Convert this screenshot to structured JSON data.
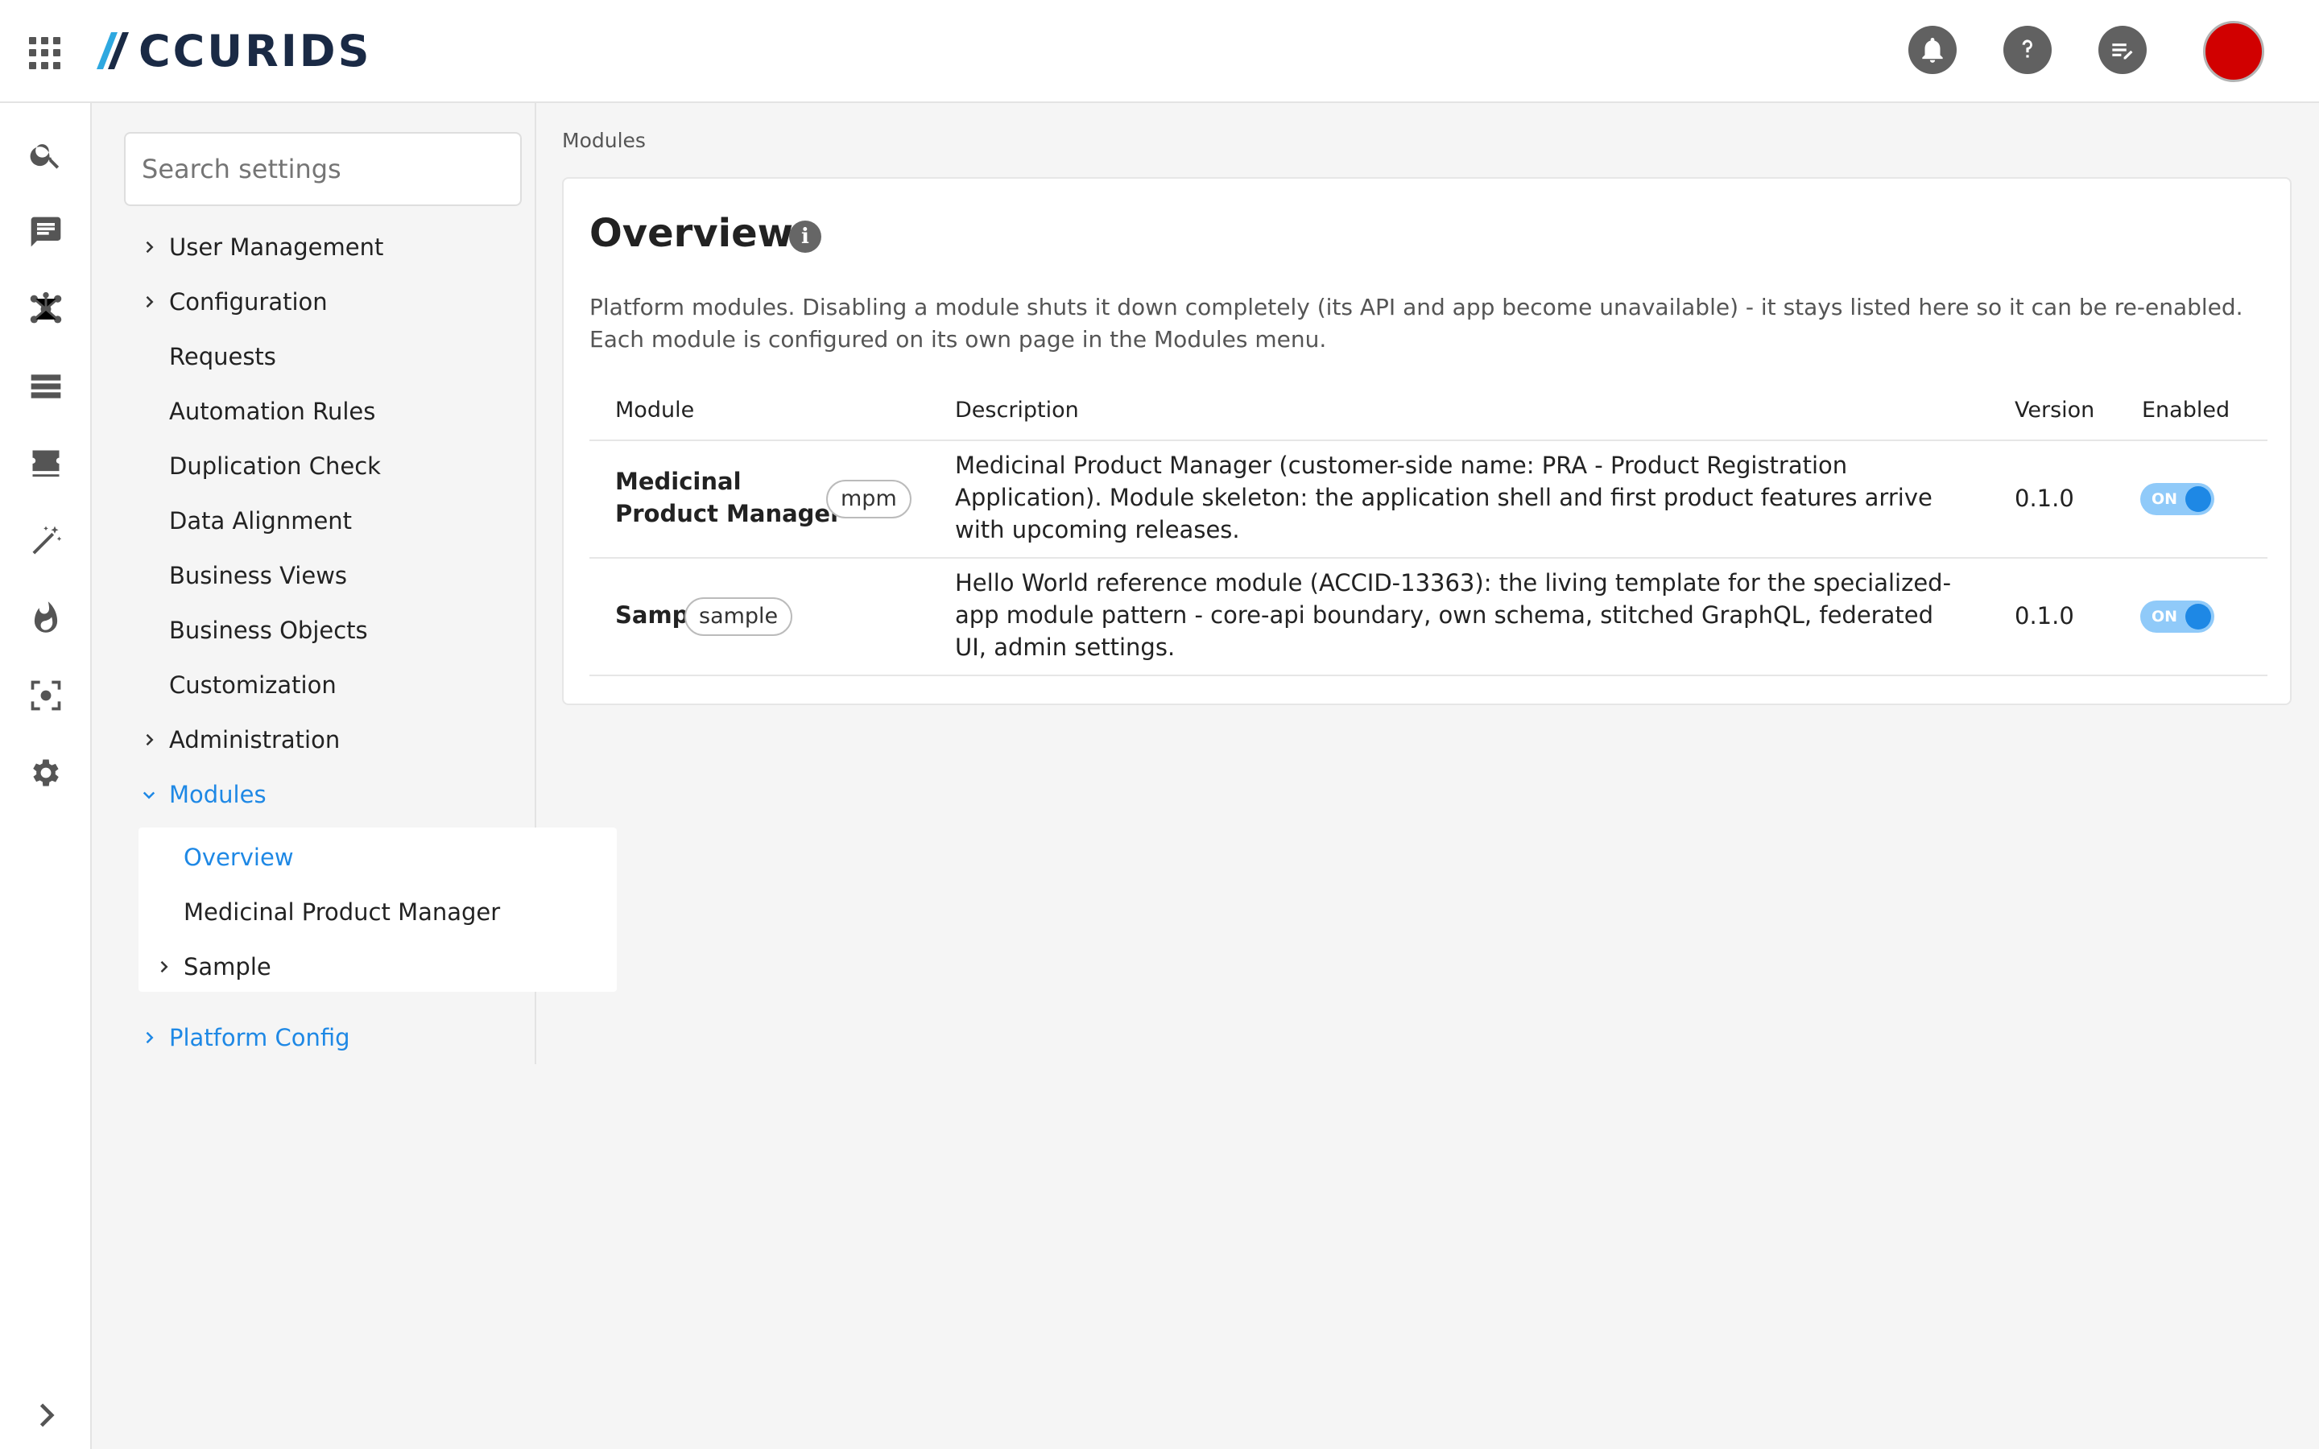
{
  "app": {
    "brand": "ACCURIDS",
    "brand_rest": "CCURIDS",
    "colors": {
      "accent": "#1e88e5",
      "avatar": "#d10000",
      "toggle_track": "#90caf9"
    }
  },
  "topbar": {
    "icons": [
      "apps-grid-icon",
      "bell-icon",
      "help-icon",
      "notes-icon"
    ]
  },
  "rail": {
    "icons": [
      "search-icon",
      "chat-icon",
      "network-icon",
      "list-icon",
      "ticket-icon",
      "magic-wand-icon",
      "flame-icon",
      "scan-icon",
      "gear-icon",
      "chevron-right-icon"
    ]
  },
  "settings_nav": {
    "search_placeholder": "Search settings",
    "items": [
      {
        "label": "User Management",
        "chevron": "right"
      },
      {
        "label": "Configuration",
        "chevron": "right"
      },
      {
        "label": "Requests"
      },
      {
        "label": "Automation Rules"
      },
      {
        "label": "Duplication Check"
      },
      {
        "label": "Data Alignment"
      },
      {
        "label": "Business Views"
      },
      {
        "label": "Business Objects"
      },
      {
        "label": "Customization"
      },
      {
        "label": "Administration",
        "chevron": "right"
      },
      {
        "label": "Modules",
        "chevron": "down",
        "active": true
      },
      {
        "label": "Platform Config",
        "chevron": "right"
      }
    ],
    "modules_sub": [
      {
        "label": "Overview",
        "active": true
      },
      {
        "label": "Medicinal Product Manager"
      },
      {
        "label": "Sample",
        "chevron": "right"
      }
    ]
  },
  "main": {
    "breadcrumb": "Modules",
    "title": "Overview",
    "info_icon": "i",
    "description": "Platform modules. Disabling a module shuts it down completely (its API and app become unavailable) - it stays listed here so it can be re-enabled. Each module is configured on its own page in the Modules menu.",
    "table": {
      "headers": {
        "module": "Module",
        "description": "Description",
        "version": "Version",
        "enabled": "Enabled"
      },
      "rows": [
        {
          "name_line1": "Medicinal",
          "name_line2": "Product Manager",
          "chip": "mpm",
          "description": "Medicinal Product Manager (customer-side name: PRA - Product Registration Application). Module skeleton: the application shell and first product features arrive with upcoming releases.",
          "version": "0.1.0",
          "enabled": true,
          "toggle_label": "ON"
        },
        {
          "name": "Sample",
          "chip": "sample",
          "description": "Hello World reference module (ACCID-13363): the living template for the specialized-app module pattern - core-api boundary, own schema, stitched GraphQL, federated UI, admin settings.",
          "version": "0.1.0",
          "enabled": true,
          "toggle_label": "ON"
        }
      ]
    }
  }
}
